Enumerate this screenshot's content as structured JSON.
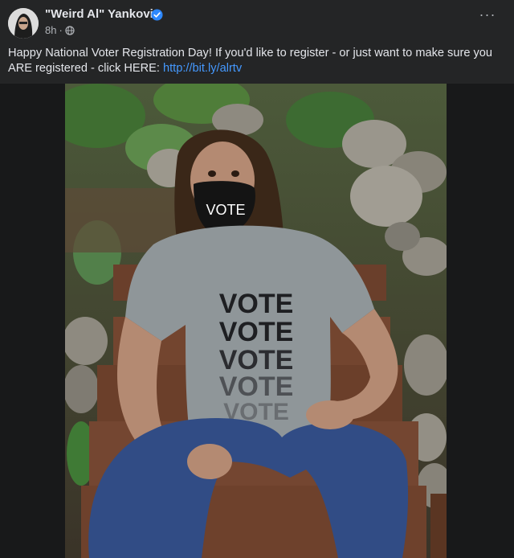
{
  "post": {
    "author": "\"Weird Al\" Yankovic",
    "timestamp": "8h",
    "meta_separator": "·",
    "privacy_icon": "globe-icon",
    "verified_icon": "verified-badge-icon",
    "more_icon": "more-options-icon",
    "more_label": "···",
    "text": "Happy National Voter Registration Day!  If you'd like to register - or just want to make sure you ARE registered - click HERE: ",
    "link": "http://bit.ly/alrtv",
    "photo": {
      "mask_text": "VOTE",
      "shirt_lines": [
        "VOTE",
        "VOTE",
        "VOTE",
        "VOTE",
        "VOTE"
      ]
    }
  },
  "colors": {
    "background": "#242526",
    "text": "#e4e6eb",
    "secondary_text": "#b0b3b8",
    "link": "#4599ff",
    "verified": "#2d88ff"
  }
}
